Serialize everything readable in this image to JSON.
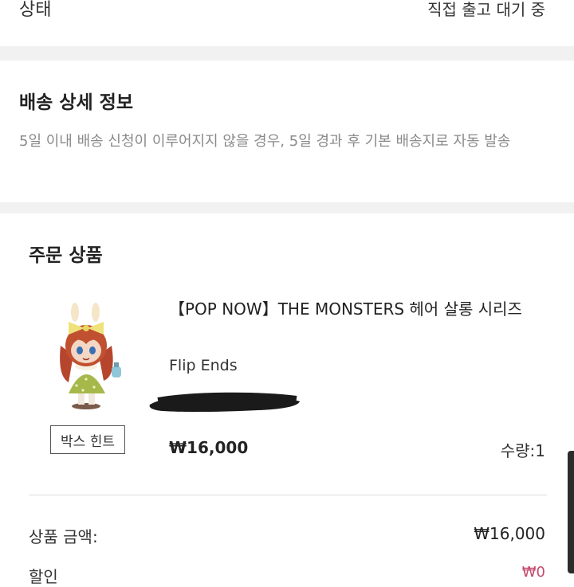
{
  "status": {
    "label": "상태",
    "value": "직접 출고 대기 중"
  },
  "shipping": {
    "title": "배송 상세 정보",
    "description": "5일 이내 배송 신청이 이루어지지 않을 경우, 5일 경과 후 기본 배송지로 자동 발송"
  },
  "order": {
    "title": "주문 상품",
    "product": {
      "name": "【POP NOW】THE MONSTERS 헤어 살롱 시리즈",
      "option": "Flip Ends",
      "price": "₩16,000",
      "quantity": "수량:1",
      "box_hint": "박스 힌트",
      "thumbnail_icon": "figure-toy-image"
    },
    "summary": {
      "subtotal_label": "상품 금액:",
      "subtotal_value": "₩16,000",
      "discount_label": "할인",
      "discount_value": "₩0"
    }
  },
  "colors": {
    "discount": "#c44a6a",
    "divider_band": "#f1f1f1"
  }
}
